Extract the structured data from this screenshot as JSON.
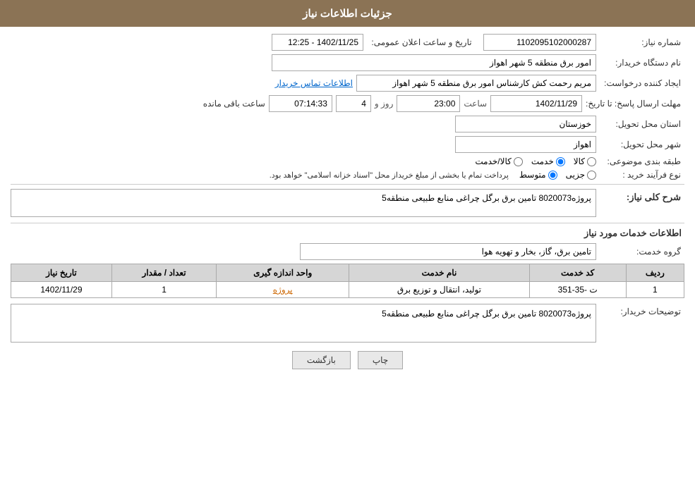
{
  "header": {
    "title": "جزئیات اطلاعات نیاز"
  },
  "form": {
    "shomara_niaz_label": "شماره نیاز:",
    "shomara_niaz_value": "1102095102000287",
    "tarikh_label": "تاریخ و ساعت اعلان عمومی:",
    "tarikh_value": "1402/11/25 - 12:25",
    "nam_dastgah_label": "نام دستگاه خریدار:",
    "nam_dastgah_value": "امور برق منطقه 5 شهر اهواز",
    "ijad_label": "ایجاد کننده درخواست:",
    "ijad_value": "مریم رحمت کش کارشناس امور برق منطقه 5 شهر اهواز",
    "ettelaat_tamas_label": "اطلاعات تماس خریدار",
    "mohlet_label": "مهلت ارسال پاسخ: تا تاریخ:",
    "mohlet_date": "1402/11/29",
    "mohlet_saat_label": "ساعت",
    "mohlet_saat_value": "23:00",
    "mohlet_roz_label": "روز و",
    "mohlet_roz_value": "4",
    "mohlet_remain_label": "ساعت باقی مانده",
    "mohlet_remain_value": "07:14:33",
    "ostan_label": "استان محل تحویل:",
    "ostan_value": "خوزستان",
    "shahr_label": "شهر محل تحویل:",
    "shahr_value": "اهواز",
    "tabaqe_label": "طبقه بندی موضوعی:",
    "tabaqe_options": [
      "کالا",
      "خدمت",
      "کالا/خدمت"
    ],
    "tabaqe_selected": "خدمت",
    "nooe_farayand_label": "نوع فرآیند خرید :",
    "nooe_farayand_options": [
      "جزیی",
      "متوسط"
    ],
    "nooe_farayand_selected": "متوسط",
    "nooe_farayand_desc": "پرداخت تمام یا بخشی از مبلغ خریداز محل \"اسناد خزانه اسلامی\" خواهد بود.",
    "sherh_niaz_label": "شرح کلی نیاز:",
    "sherh_niaz_value": "پروژه8020073 تامین برق برگل چراغی منابع طبیعی منطقه5",
    "service_section_title": "اطلاعات خدمات مورد نیاز",
    "group_khadamat_label": "گروه خدمت:",
    "group_khadamat_value": "تامین برق، گاز، بخار و تهویه هوا",
    "table": {
      "headers": [
        "ردیف",
        "کد خدمت",
        "نام خدمت",
        "واحد اندازه گیری",
        "تعداد / مقدار",
        "تاریخ نیاز"
      ],
      "rows": [
        {
          "radif": "1",
          "kod_khadamat": "ت -35-351",
          "nam_khadamat": "تولید، انتقال و توزیع برق",
          "vahed": "پروژه",
          "tedad": "1",
          "tarikh": "1402/11/29"
        }
      ]
    },
    "tawsif_label": "توضیحات خریدار:",
    "tawsif_value": "پروژه8020073 تامین برق برگل چراغی منابع طبیعی منطقه5"
  },
  "buttons": {
    "print_label": "چاپ",
    "back_label": "بازگشت"
  }
}
